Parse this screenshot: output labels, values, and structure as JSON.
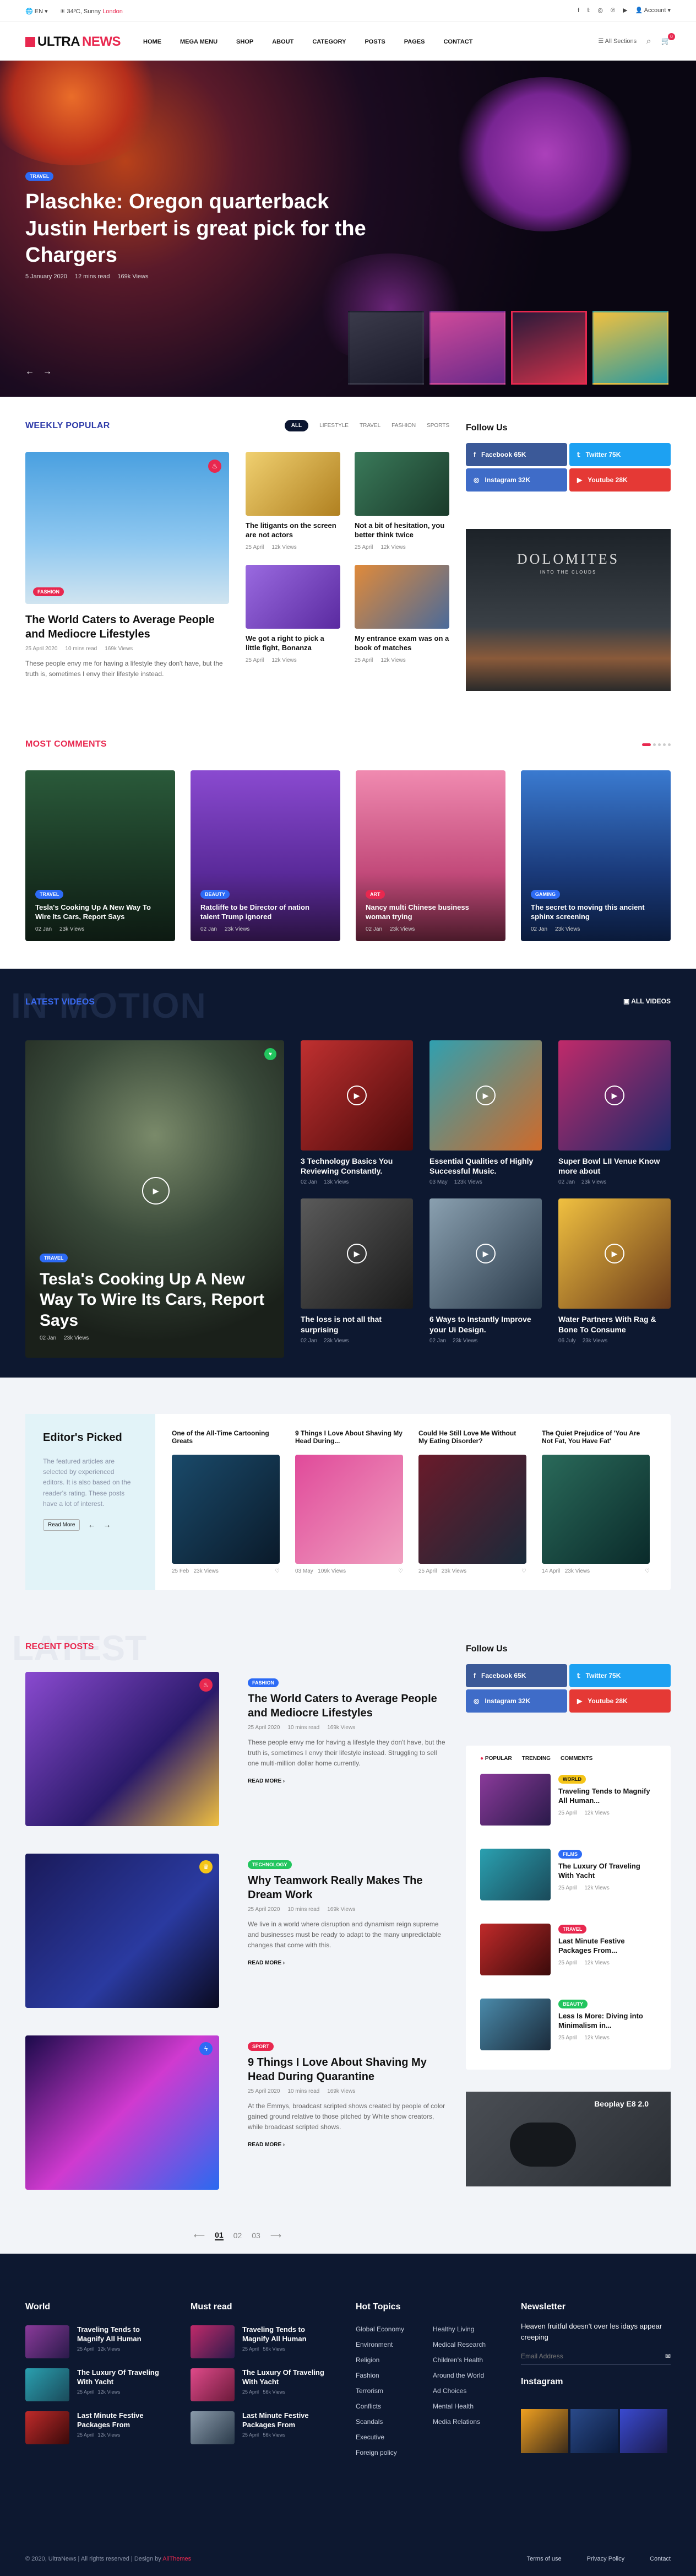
{
  "topbar": {
    "lang": "EN",
    "weather": "34ºC, Sunny",
    "city": "London",
    "account": "Account"
  },
  "logo": {
    "a": "ULTRA",
    "b": "NEWS"
  },
  "menu": [
    "HOME",
    "MEGA MENU",
    "SHOP",
    "ABOUT",
    "CATEGORY",
    "POSTS",
    "PAGES",
    "CONTACT"
  ],
  "nav_right": {
    "sections": "All Sections",
    "cart_count": "0"
  },
  "hero": {
    "badge": "TRAVEL",
    "title": "Plaschke: Oregon quarterback Justin Herbert is great pick for the Chargers",
    "date": "5 January 2020",
    "read": "12 mins read",
    "views": "169k Views"
  },
  "weekly": {
    "title": "WEEKLY POPULAR",
    "tabs": [
      "ALL",
      "LIFESTYLE",
      "TRAVEL",
      "FASHION",
      "SPORTS"
    ],
    "main": {
      "badge": "FASHION",
      "title": "The World Caters to Average People and Mediocre Lifestyles",
      "date": "25 April 2020",
      "read": "10 mins read",
      "views": "169k Views",
      "excerpt": "These people envy me for having a lifestyle they don't have, but the truth is, sometimes I envy their lifestyle instead."
    },
    "small": [
      {
        "title": "The litigants on the screen are not actors",
        "date": "25 April",
        "views": "12k Views",
        "color": "#d9b340"
      },
      {
        "title": "Not a bit of hesitation, you better think twice",
        "date": "25 April",
        "views": "12k Views",
        "color": "#2f6b4a"
      },
      {
        "title": "We got a right to pick a little fight, Bonanza",
        "date": "25 April",
        "views": "12k Views",
        "color": "#7a4fc7"
      },
      {
        "title": "My entrance exam was on a book of matches",
        "date": "25 April",
        "views": "12k Views",
        "color": "#c5632a"
      }
    ]
  },
  "follow": {
    "title": "Follow Us",
    "fb": "Facebook 65K",
    "tw": "Twitter 75K",
    "ig": "Instagram 32K",
    "yt": "Youtube 28K"
  },
  "ad1": {
    "title": "DOLOMITES",
    "sub": "INTO THE CLOUDS"
  },
  "comments": {
    "title": "MOST COMMENTS",
    "items": [
      {
        "badge": "TRAVEL",
        "title": "Tesla's Cooking Up A New Way To Wire Its Cars, Report Says",
        "date": "02 Jan",
        "views": "23k Views",
        "color": "#2a4a35"
      },
      {
        "badge": "BEAUTY",
        "title": "Ratcliffe to be Director of nation talent Trump ignored",
        "date": "02 Jan",
        "views": "23k Views",
        "color": "#7b3fc2"
      },
      {
        "badge": "ART",
        "title": "Nancy multi Chinese business woman trying",
        "date": "02 Jan",
        "views": "23k Views",
        "color": "#e45a8a"
      },
      {
        "badge": "GAMING",
        "title": "The secret to moving this ancient sphinx screening",
        "date": "02 Jan",
        "views": "23k Views",
        "color": "#2a5fa8"
      }
    ]
  },
  "videos": {
    "bgword": "IN MOTION",
    "title": "LATEST VIDEOS",
    "all": "ALL VIDEOS",
    "main": {
      "badge": "TRAVEL",
      "title": "Tesla's Cooking Up A New Way To Wire Its Cars, Report Says",
      "date": "02 Jan",
      "views": "23k Views"
    },
    "items": [
      {
        "title": "3 Technology Basics You Reviewing Constantly.",
        "date": "02 Jan",
        "views": "13k Views",
        "color": "#8b1a1a"
      },
      {
        "title": "Essential Qualities of Highly Successful Music.",
        "date": "03 May",
        "views": "123k Views",
        "color": "#1f7a8c"
      },
      {
        "title": "Super Bowl LII Venue Know more about",
        "date": "02 Jan",
        "views": "23k Views",
        "color": "#7a1f4a"
      },
      {
        "title": "The loss is not all that surprising",
        "date": "02 Jan",
        "views": "23k Views",
        "color": "#3a3a3a"
      },
      {
        "title": "6 Ways to Instantly Improve your Ui Design.",
        "date": "02 Jan",
        "views": "23k Views",
        "color": "#4a6070"
      },
      {
        "title": "Water Partners With Rag & Bone To Consume",
        "date": "06 July",
        "views": "23k Views",
        "color": "#d6a22a"
      }
    ]
  },
  "editors": {
    "title": "Editor's Picked",
    "desc": "The featured articles are selected by experienced editors. It is also based on the reader's rating. These posts have a lot of interest.",
    "btn": "Read More",
    "items": [
      {
        "title": "One of the All-Time Cartooning Greats",
        "date": "25 Feb",
        "views": "23k Views",
        "color": "#1a4a6a"
      },
      {
        "title": "9 Things I Love About Shaving My Head During...",
        "date": "03 May",
        "views": "109k Views",
        "color": "#d63a8a"
      },
      {
        "title": "Could He Still Love Me Without My Eating Disorder?",
        "date": "25 April",
        "views": "23k Views",
        "color": "#3a2020"
      },
      {
        "title": "The Quiet Prejudice of 'You Are Not Fat, You Have Fat'",
        "date": "14 April",
        "views": "23k Views",
        "color": "#1f5a4f"
      }
    ]
  },
  "recent": {
    "bgword": "LATEST",
    "title": "RECENT POSTS",
    "readmore": "READ MORE",
    "items": [
      {
        "badge": "FASHION",
        "title": "The World Caters to Average People and Mediocre Lifestyles",
        "date": "25 April 2020",
        "read": "10 mins read",
        "views": "169k Views",
        "excerpt": "These people envy me for having a lifestyle they don't have, but the truth is, sometimes I envy their lifestyle instead. Struggling to sell one multi-million dollar home currently.",
        "color": "#4a2a8a"
      },
      {
        "badge": "TECHNOLOGY",
        "title": "Why Teamwork Really Makes The Dream Work",
        "date": "25 April 2020",
        "read": "10 mins read",
        "views": "169k Views",
        "excerpt": "We live in a world where disruption and dynamism reign supreme and businesses must be ready to adapt to the many unpredictable changes that come with this.",
        "color": "#1a2a7a"
      },
      {
        "badge": "SPORT",
        "title": "9 Things I Love About Shaving My Head During Quarantine",
        "date": "25 April 2020",
        "read": "10 mins read",
        "views": "169k Views",
        "excerpt": "At the Emmys, broadcast scripted shows created by people of color gained ground relative to those pitched by White show creators, while broadcast scripted shows.",
        "color": "#2a1a6a"
      }
    ]
  },
  "sidebar_popular": {
    "tabs": [
      "POPULAR",
      "TRENDING",
      "COMMENTS"
    ],
    "items": [
      {
        "badge": "WORLD",
        "title": "Traveling Tends to Magnify All Human...",
        "date": "25 April",
        "views": "12k Views",
        "color": "#5a2a6a"
      },
      {
        "badge": "FILMS",
        "title": "The Luxury Of Traveling With Yacht",
        "date": "25 April",
        "views": "12k Views",
        "color": "#1f6a7a"
      },
      {
        "badge": "TRAVEL",
        "title": "Last Minute Festive Packages From...",
        "date": "25 April",
        "views": "12k Views",
        "color": "#8a1a1a"
      },
      {
        "badge": "BEAUTY",
        "title": "Less Is More: Diving into Minimalism in...",
        "date": "25 April",
        "views": "12k Views",
        "color": "#3a6a8a"
      }
    ]
  },
  "ad2": {
    "title": "Beoplay E8 2.0"
  },
  "pagination": [
    "01",
    "02",
    "03"
  ],
  "footer": {
    "world": {
      "title": "World",
      "items": [
        {
          "title": "Traveling Tends to Magnify All Human",
          "date": "25 April",
          "views": "12k Views"
        },
        {
          "title": "The Luxury Of Traveling With Yacht",
          "date": "25 April",
          "views": "12k Views"
        },
        {
          "title": "Last Minute Festive Packages From",
          "date": "25 April",
          "views": "12k Views"
        }
      ]
    },
    "must": {
      "title": "Must read",
      "items": [
        {
          "title": "Traveling Tends to Magnify All Human",
          "date": "25 April",
          "views": "56k Views"
        },
        {
          "title": "The Luxury Of Traveling With Yacht",
          "date": "25 April",
          "views": "56k Views"
        },
        {
          "title": "Last Minute Festive Packages From",
          "date": "25 April",
          "views": "56k Views"
        }
      ]
    },
    "topics": {
      "title": "Hot Topics",
      "items": [
        "Global Economy",
        "Healthy Living",
        "Environment",
        "Medical Research",
        "Religion",
        "Children's Health",
        "Fashion",
        "Around the World",
        "Terrorism",
        "Ad Choices",
        "Conflicts",
        "Mental Health",
        "Scandals",
        "Media Relations",
        "Executive",
        "",
        "Foreign policy",
        ""
      ]
    },
    "newsletter": {
      "title": "Newsletter",
      "text": "Heaven fruitful doesn't over les idays appear creeping",
      "placeholder": "Email Address",
      "ig": "Instagram"
    },
    "copyright": "© 2020, UltraNews | All rights reserved | Design by",
    "designer": "AliThemes",
    "links": [
      "Terms of use",
      "Privacy Policy",
      "Contact"
    ]
  }
}
